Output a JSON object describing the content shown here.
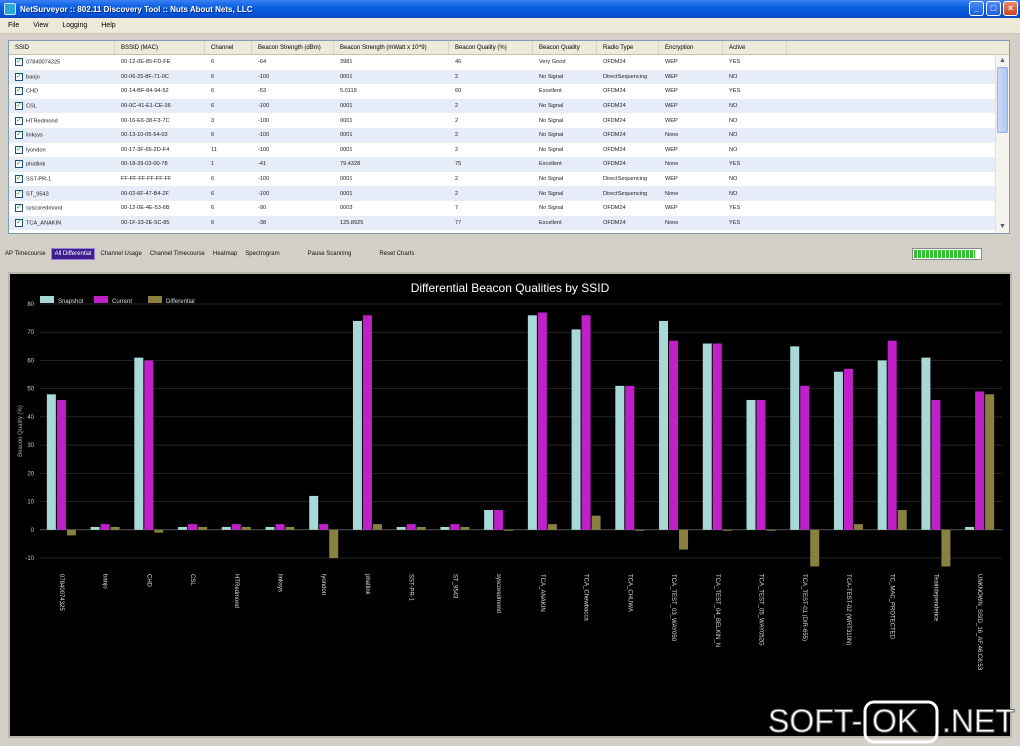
{
  "window": {
    "title": "NetSurveyor :: 802.11 Discovery Tool :: Nuts About Nets, LLC",
    "min": "_",
    "max": "□",
    "close": "×"
  },
  "menu": [
    "File",
    "View",
    "Logging",
    "Help"
  ],
  "table": {
    "columns": [
      "SSID",
      "BSSID (MAC)",
      "Channel",
      "Beacon Strength (dBm)",
      "Beacon Strength (mWatt x 10^9)",
      "Beacon Quality (%)",
      "Beacon Quality",
      "Radio Type",
      "Encryption",
      "Active"
    ],
    "rows": [
      [
        "07840074325",
        "00-12-0E-85-FD-FE",
        "6",
        "-64",
        "3981",
        "46",
        "Very Good",
        "OFDM24",
        "WEP",
        "YES"
      ],
      [
        "banjo",
        "00-06-25-8F-71-0C",
        "6",
        "-100",
        "0001",
        "2",
        "No Signal",
        "DirectSequencing",
        "WEP",
        "NO"
      ],
      [
        "CHD",
        "00-14-BF-84-94-52",
        "6",
        "-53",
        "5.0119",
        "60",
        "Excellent",
        "OFDM24",
        "WEP",
        "YES"
      ],
      [
        "CSL",
        "00-0C-41-E1-CE-36",
        "6",
        "-100",
        "0001",
        "2",
        "No Signal",
        "OFDM24",
        "WEP",
        "NO"
      ],
      [
        "HTRedmond",
        "00-16-E6-38-F3-7C",
        "3",
        "-100",
        "0001",
        "2",
        "No Signal",
        "OFDM24",
        "WEP",
        "NO"
      ],
      [
        "linksys",
        "00-13-10-05-54-03",
        "6",
        "-100",
        "0001",
        "2",
        "No Signal",
        "OFDM24",
        "None",
        "NO"
      ],
      [
        "lyondon",
        "00-17-3F-66-2D-F4",
        "11",
        "-100",
        "0001",
        "2",
        "No Signal",
        "OFDM24",
        "WEP",
        "NO"
      ],
      [
        "phatlink",
        "00-18-39-03-00-78",
        "1",
        "-41",
        "79.4328",
        "75",
        "Excellent",
        "OFDM24",
        "None",
        "YES"
      ],
      [
        "SST-PR-1",
        "FF-FF-FF-FF-FF-FF",
        "6",
        "-100",
        "0001",
        "2",
        "No Signal",
        "DirectSequencing",
        "WEP",
        "NO"
      ],
      [
        "ST_9543",
        "00-02-6F-47-B4-2F",
        "6",
        "-100",
        "0001",
        "2",
        "No Signal",
        "DirectSequencing",
        "None",
        "NO"
      ],
      [
        "syscoredmond",
        "00-12-0E-4E-53-6B",
        "6",
        "-90",
        "0003",
        "7",
        "No Signal",
        "OFDM24",
        "WEP",
        "YES"
      ],
      [
        "TCA_ANAKIN",
        "00-1F-33-2E-5C-85",
        "6",
        "-38",
        "125.8925",
        "77",
        "Excellent",
        "OFDM24",
        "None",
        "YES"
      ]
    ]
  },
  "tabs": [
    "AP Timecourse",
    "All Differential",
    "Channel Usage",
    "Channel Timecourse",
    "Heatmap",
    "Spectrogram"
  ],
  "active_tab": 1,
  "controls": {
    "pause": "Pause Scanning",
    "reset": "Reset Charts"
  },
  "scan_progress_fraction": 0.92,
  "colors": {
    "snapshot": "#a8d8d8",
    "current": "#c020c8",
    "differential": "#8a8040",
    "active_tab": "#3c1f8c"
  },
  "chart_data": {
    "type": "bar",
    "title": "Differential Beacon Qualities by SSID",
    "ylabel": "Beacon Quality (%)",
    "ylim": [
      -10,
      80
    ],
    "yticks": [
      -10,
      0,
      10,
      20,
      30,
      40,
      50,
      60,
      70,
      80
    ],
    "grid": true,
    "legend_placement": "top-left",
    "categories": [
      "07840074325",
      "banjo",
      "CHD",
      "CSL",
      "HTRedmond",
      "linksys",
      "lyondon",
      "phatlink",
      "SST-PR-1",
      "ST_9543",
      "syscoredmond",
      "TCA_ANAKIN",
      "TCA_Chewbacca",
      "TCA_CHUWA",
      "TCA_TEST_03_WAY050",
      "TCA_TEST_04_BELKIN_N",
      "TCA_TEST_05_WAY052G",
      "TCA_TEST-01 (DIR-655)",
      "TCA-TEST-02 (WRT310N)",
      "TC_MAC_PROTECTED",
      "Teaindependence",
      "UNKNOWN_SSID_16_AF:46:C6:53"
    ],
    "series": [
      {
        "name": "Snapshot",
        "values": [
          48,
          1,
          61,
          1,
          1,
          1,
          12,
          74,
          1,
          1,
          7,
          76,
          71,
          51,
          74,
          66,
          46,
          65,
          56,
          60,
          61,
          1
        ]
      },
      {
        "name": "Current",
        "values": [
          46,
          2,
          60,
          2,
          2,
          2,
          2,
          76,
          2,
          2,
          7,
          77,
          76,
          51,
          67,
          66,
          46,
          51,
          57,
          67,
          46,
          49
        ]
      },
      {
        "name": "Differential",
        "values": [
          -2,
          1,
          -1,
          1,
          1,
          1,
          -10,
          2,
          1,
          1,
          0,
          2,
          5,
          0,
          -7,
          0,
          0,
          -13,
          2,
          7,
          -13,
          48
        ]
      }
    ]
  },
  "watermark": {
    "left": "SOFT-",
    "box": "OK",
    "right": ".NET"
  }
}
